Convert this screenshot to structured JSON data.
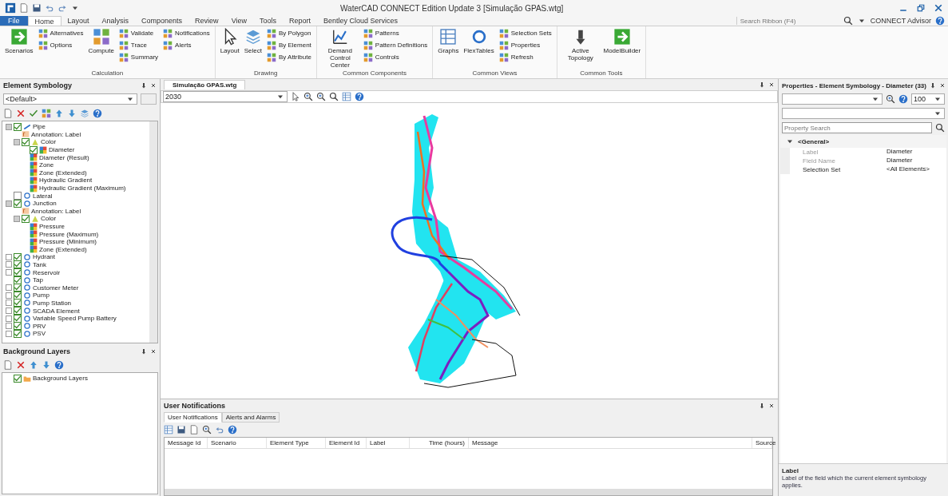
{
  "window": {
    "title": "WaterCAD CONNECT Edition Update 3 [Simulação GPAS.wtg]",
    "search_placeholder": "Search Ribbon (F4)",
    "advisor": "CONNECT Advisor"
  },
  "ribbon": {
    "tabs": [
      {
        "label": "File",
        "selected": false,
        "kind": "file"
      },
      {
        "label": "Home",
        "selected": true,
        "kind": "tab"
      },
      {
        "label": "Layout",
        "selected": false,
        "kind": "tab"
      },
      {
        "label": "Analysis",
        "selected": false,
        "kind": "tab"
      },
      {
        "label": "Components",
        "selected": false,
        "kind": "tab"
      },
      {
        "label": "Review",
        "selected": false,
        "kind": "tab"
      },
      {
        "label": "View",
        "selected": false,
        "kind": "tab"
      },
      {
        "label": "Tools",
        "selected": false,
        "kind": "tab"
      },
      {
        "label": "Report",
        "selected": false,
        "kind": "tab"
      },
      {
        "label": "Bentley Cloud Services",
        "selected": false,
        "kind": "tab"
      }
    ],
    "groups": [
      {
        "label": "Calculation",
        "items": [
          {
            "label": "Scenarios",
            "kind": "large"
          },
          {
            "label": "Alternatives",
            "kind": "small"
          },
          {
            "label": "Options",
            "kind": "small"
          },
          {
            "label": "Compute",
            "kind": "large"
          },
          {
            "label": "Validate",
            "kind": "small"
          },
          {
            "label": "Trace",
            "kind": "small"
          },
          {
            "label": "Summary",
            "kind": "small"
          },
          {
            "label": "Notifications",
            "kind": "small"
          },
          {
            "label": "Alerts",
            "kind": "small"
          }
        ]
      },
      {
        "label": "Drawing",
        "items": [
          {
            "label": "Layout",
            "kind": "large"
          },
          {
            "label": "Select",
            "kind": "large"
          },
          {
            "label": "By Polygon",
            "kind": "small"
          },
          {
            "label": "By Element",
            "kind": "small"
          },
          {
            "label": "By Attribute",
            "kind": "small"
          }
        ]
      },
      {
        "label": "Common Components",
        "items": [
          {
            "label": "Demand Control Center",
            "kind": "large"
          },
          {
            "label": "Patterns",
            "kind": "small"
          },
          {
            "label": "Pattern Definitions",
            "kind": "small"
          },
          {
            "label": "Controls",
            "kind": "small"
          }
        ]
      },
      {
        "label": "Common Views",
        "items": [
          {
            "label": "Graphs",
            "kind": "large"
          },
          {
            "label": "FlexTables",
            "kind": "large"
          },
          {
            "label": "Selection Sets",
            "kind": "small"
          },
          {
            "label": "Properties",
            "kind": "small"
          },
          {
            "label": "Refresh",
            "kind": "small"
          }
        ]
      },
      {
        "label": "Common Tools",
        "items": [
          {
            "label": "Active Topology",
            "kind": "large"
          },
          {
            "label": "ModelBuilder",
            "kind": "large"
          }
        ]
      }
    ]
  },
  "symbology": {
    "title": "Element Symbology",
    "definition": "<Default>",
    "tree": [
      {
        "label": "Pipe",
        "kind": "element",
        "checked": true,
        "expanded": true,
        "children": [
          {
            "label": "Annotation: Label",
            "kind": "annotation"
          },
          {
            "label": "Color",
            "kind": "color",
            "checked": true,
            "expanded": true,
            "children": [
              {
                "label": "Diameter",
                "kind": "range",
                "checked": true
              },
              {
                "label": "Diameter (Result)",
                "kind": "range"
              },
              {
                "label": "Zone",
                "kind": "range"
              },
              {
                "label": "Zone (Extended)",
                "kind": "range"
              },
              {
                "label": "Hydraulic Gradient",
                "kind": "range"
              },
              {
                "label": "Hydraulic Gradient (Maximum)",
                "kind": "range"
              }
            ]
          }
        ]
      },
      {
        "label": "Lateral",
        "kind": "element",
        "checked": false
      },
      {
        "label": "Junction",
        "kind": "element",
        "checked": true,
        "expanded": true,
        "children": [
          {
            "label": "Annotation: Label",
            "kind": "annotation"
          },
          {
            "label": "Color",
            "kind": "color",
            "checked": true,
            "expanded": true,
            "children": [
              {
                "label": "Pressure",
                "kind": "range"
              },
              {
                "label": "Pressure (Maximum)",
                "kind": "range"
              },
              {
                "label": "Pressure (Minimum)",
                "kind": "range"
              },
              {
                "label": "Zone (Extended)",
                "kind": "range"
              }
            ]
          }
        ]
      },
      {
        "label": "Hydrant",
        "kind": "element",
        "checked": true,
        "expanded": false
      },
      {
        "label": "Tank",
        "kind": "element",
        "checked": true,
        "expanded": false
      },
      {
        "label": "Reservoir",
        "kind": "element",
        "checked": true,
        "expanded": false
      },
      {
        "label": "Tap",
        "kind": "element",
        "checked": true
      },
      {
        "label": "Customer Meter",
        "kind": "element",
        "checked": true,
        "expanded": false
      },
      {
        "label": "Pump",
        "kind": "element",
        "checked": true,
        "expanded": false
      },
      {
        "label": "Pump Station",
        "kind": "element",
        "checked": true,
        "expanded": false
      },
      {
        "label": "SCADA Element",
        "kind": "element",
        "checked": true,
        "expanded": false
      },
      {
        "label": "Variable Speed Pump Battery",
        "kind": "element",
        "checked": true,
        "expanded": false
      },
      {
        "label": "PRV",
        "kind": "element",
        "checked": true,
        "expanded": false
      },
      {
        "label": "PSV",
        "kind": "element",
        "checked": true,
        "expanded": false
      }
    ]
  },
  "background_layers": {
    "title": "Background Layers",
    "tree": [
      {
        "label": "Background Layers",
        "kind": "folder",
        "checked": true
      }
    ]
  },
  "document": {
    "tab": "Simulação GPAS.wtg",
    "scenario": "2030"
  },
  "notifications": {
    "title": "User Notifications",
    "tabs": [
      {
        "label": "User Notifications",
        "selected": true
      },
      {
        "label": "Alerts and Alarms",
        "selected": false
      }
    ],
    "columns": [
      "Message Id",
      "Scenario",
      "Element Type",
      "Element Id",
      "Label",
      "Time (hours)",
      "Message",
      "Source"
    ]
  },
  "properties": {
    "title": "Properties - Element Symbology - Diameter (33)",
    "zoom": "100",
    "search_placeholder": "Property Search",
    "category": "<General>",
    "rows": [
      {
        "name": "Label",
        "value": "Diameter",
        "disabled": true
      },
      {
        "name": "Field Name",
        "value": "Diameter",
        "disabled": true
      },
      {
        "name": "Selection Set",
        "value": "<All Elements>",
        "disabled": false
      }
    ],
    "help_title": "Label",
    "help_text": "Label of the field which the current element symbology applies."
  }
}
